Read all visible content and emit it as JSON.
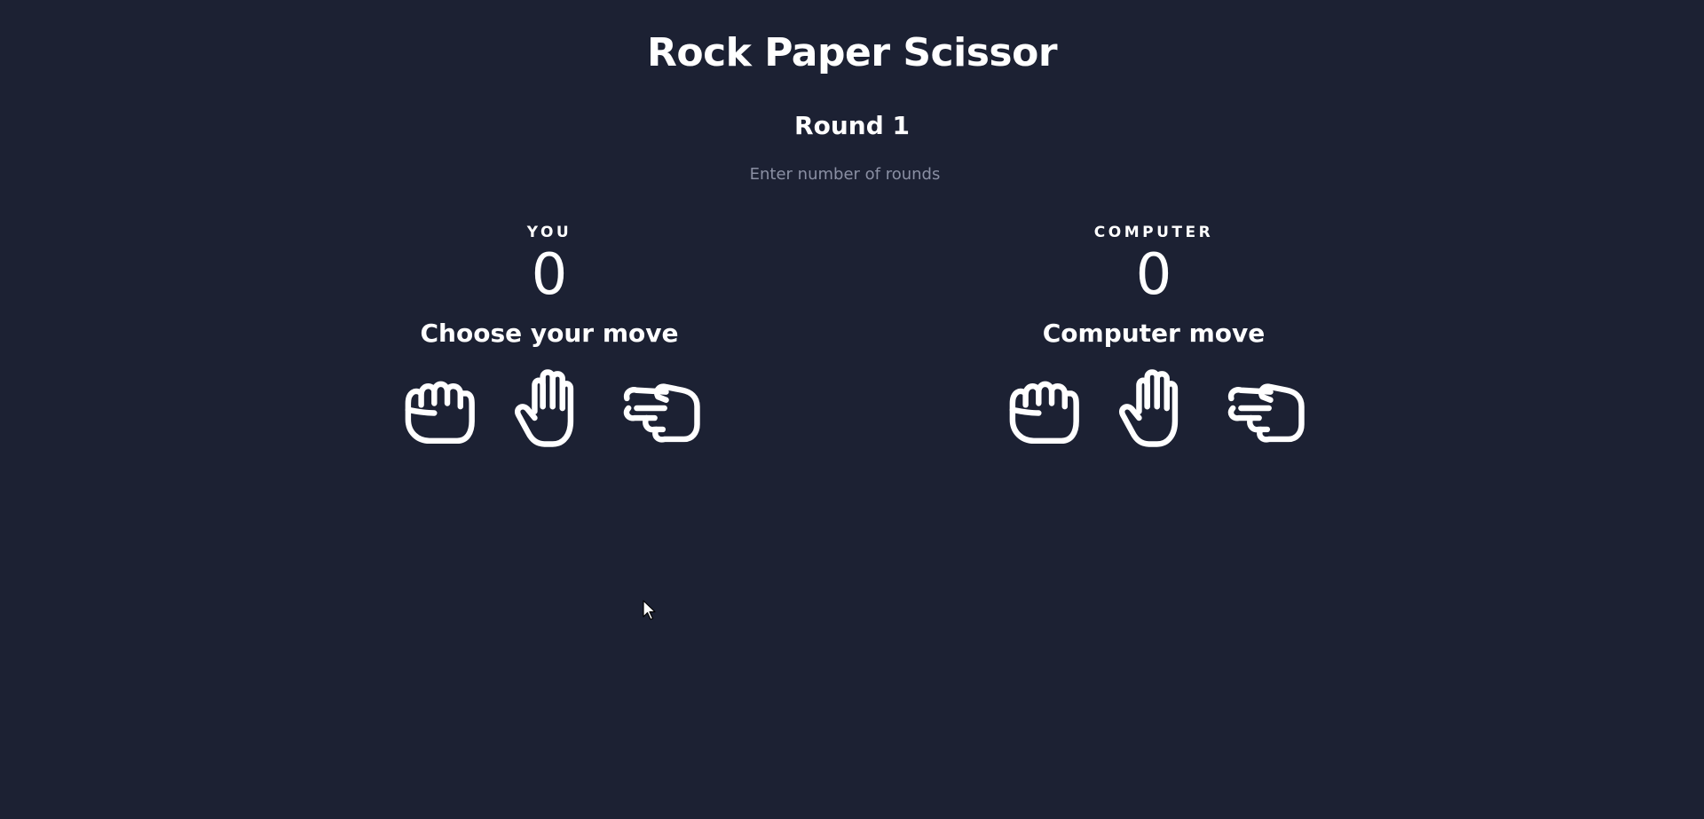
{
  "header": {
    "title": "Rock Paper Scissor",
    "round_label": "Round 1"
  },
  "rounds_input": {
    "placeholder": "Enter number of rounds",
    "value": ""
  },
  "player": {
    "label": "YOU",
    "score": "0",
    "move_heading": "Choose your move",
    "moves": [
      "rock-icon",
      "paper-icon",
      "scissors-icon"
    ]
  },
  "computer": {
    "label": "COMPUTER",
    "score": "0",
    "move_heading": "Computer move",
    "moves": [
      "rock-icon",
      "paper-icon",
      "scissors-icon"
    ]
  },
  "colors": {
    "background": "#1c2133",
    "text": "#ffffff",
    "placeholder": "#8a8fa3"
  }
}
